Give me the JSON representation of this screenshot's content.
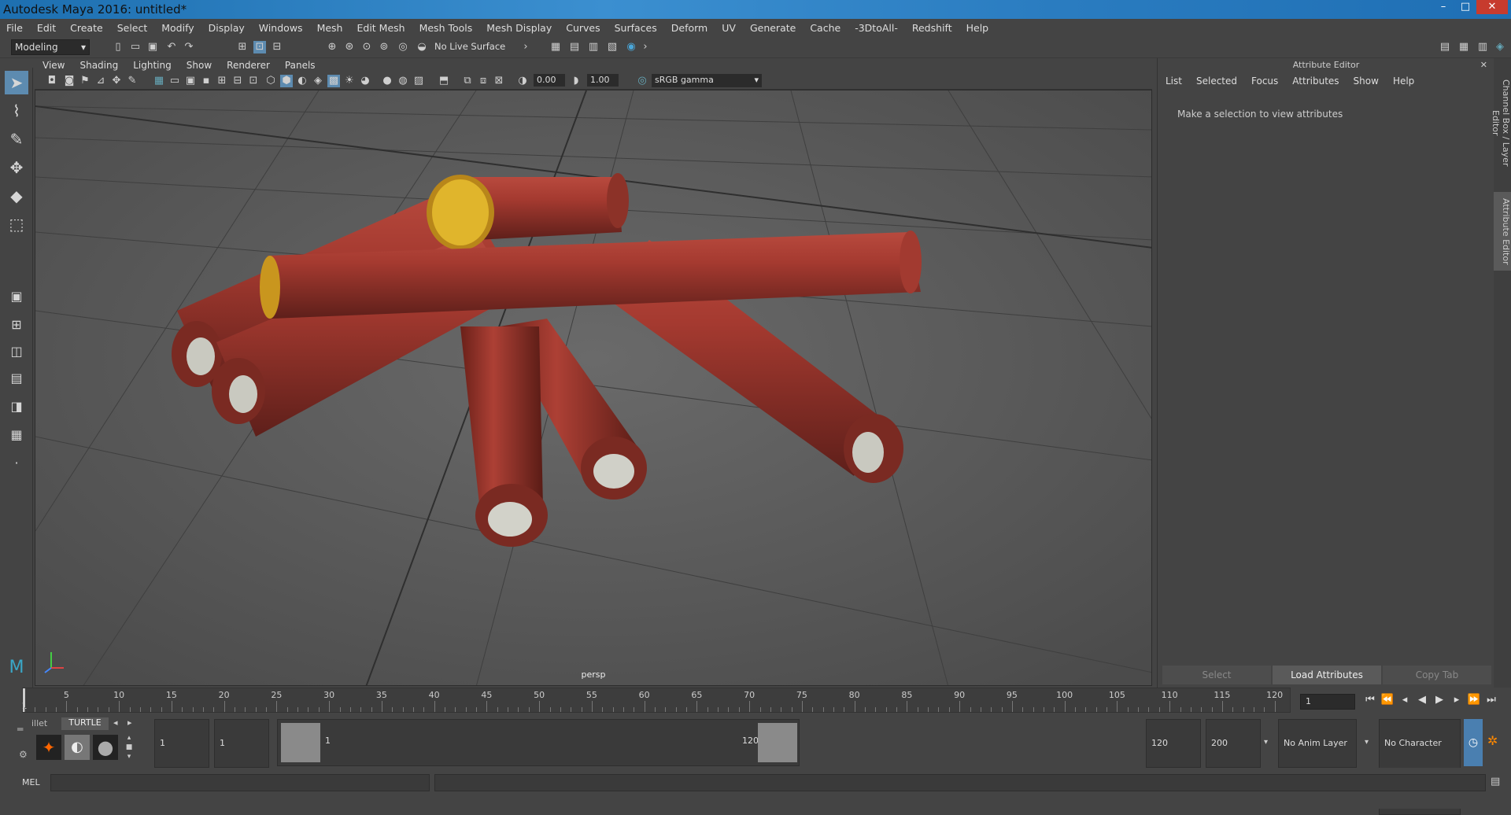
{
  "window": {
    "title": "Autodesk Maya 2016: untitled*",
    "minimize": "–",
    "maximize": "□",
    "close": "✕"
  },
  "menubar": [
    "File",
    "Edit",
    "Create",
    "Select",
    "Modify",
    "Display",
    "Windows",
    "Mesh",
    "Edit Mesh",
    "Mesh Tools",
    "Mesh Display",
    "Curves",
    "Surfaces",
    "Deform",
    "UV",
    "Generate",
    "Cache",
    "-3DtoAll-",
    "Redshift",
    "Help"
  ],
  "statusline": {
    "mode": "Modeling",
    "live_surface": "No Live Surface"
  },
  "viewport_menu": [
    "View",
    "Shading",
    "Lighting",
    "Show",
    "Renderer",
    "Panels"
  ],
  "viewport_toolbar": {
    "exposure": "0.00",
    "gamma": "1.00",
    "colorspace": "sRGB gamma"
  },
  "viewport": {
    "camera_label": "persp"
  },
  "attribute_editor": {
    "title": "Attribute Editor",
    "menu": [
      "List",
      "Selected",
      "Focus",
      "Attributes",
      "Show",
      "Help"
    ],
    "message": "Make a selection to view attributes",
    "buttons": {
      "select": "Select",
      "load": "Load Attributes",
      "copy": "Copy Tab"
    }
  },
  "side_tabs": {
    "channel_box": "Channel Box / Layer Editor",
    "attribute_editor": "Attribute Editor"
  },
  "timeline": {
    "ticks": [
      "5",
      "10",
      "15",
      "20",
      "25",
      "30",
      "35",
      "40",
      "45",
      "50",
      "55",
      "60",
      "65",
      "70",
      "75",
      "80",
      "85",
      "90",
      "95",
      "100",
      "105",
      "110",
      "115",
      "120"
    ],
    "start_label": "1",
    "current_frame": "1"
  },
  "shelf": {
    "tab_left": "illet",
    "tab_active": "TURTLE"
  },
  "range": {
    "start": "1",
    "anim_start": "1",
    "slider_start": "1",
    "slider_end": "120",
    "end": "120",
    "anim_end": "200",
    "anim_layer": "No Anim Layer",
    "char_set": "No Character Set"
  },
  "command": {
    "label": "MEL"
  }
}
